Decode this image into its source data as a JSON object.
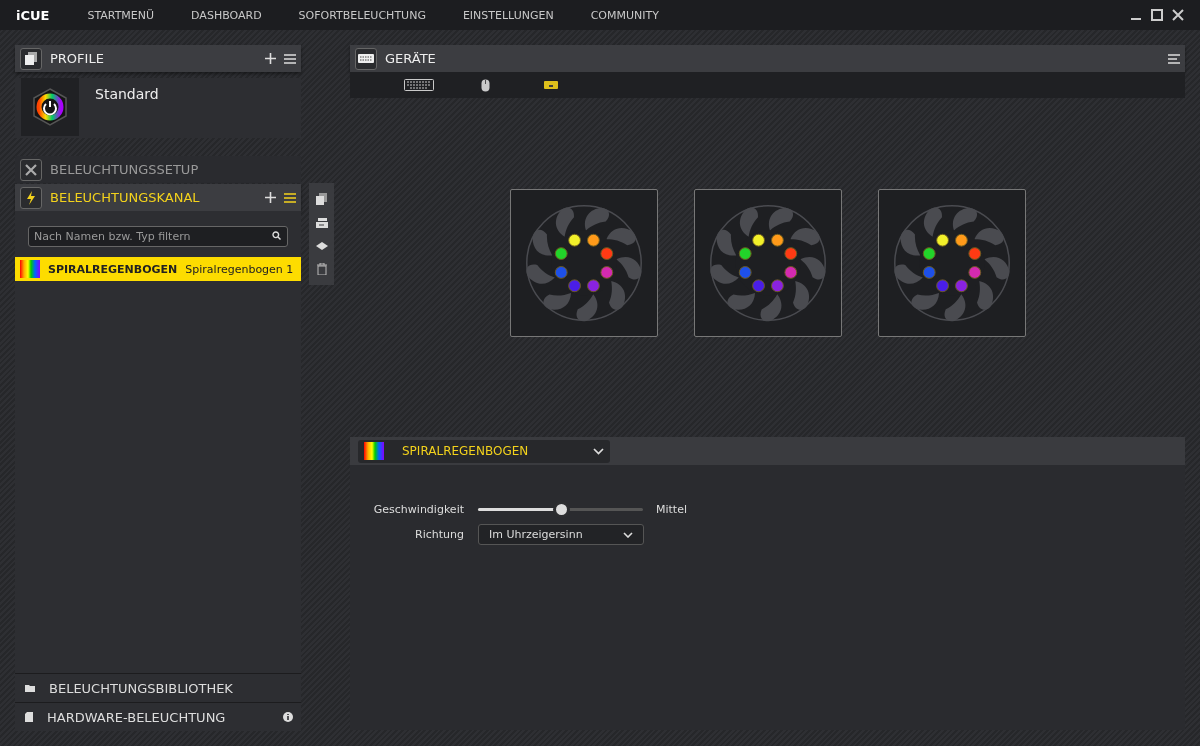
{
  "app": {
    "logo": "iCUE",
    "nav": [
      {
        "label": "STARTMENÜ"
      },
      {
        "label": "DASHBOARD"
      },
      {
        "label": "SOFORTBELEUCHTUNG"
      },
      {
        "label": "EINSTELLUNGEN"
      },
      {
        "label": "COMMUNITY"
      }
    ]
  },
  "profiles": {
    "title": "PROFILE",
    "items": [
      {
        "name": "Standard"
      }
    ]
  },
  "lighting_setup": {
    "title": "BELEUCHTUNGSSETUP"
  },
  "lighting_channel": {
    "title": "BELEUCHTUNGSKANAL",
    "search": {
      "placeholder": "Nach Namen bzw. Typ filtern"
    },
    "effects": [
      {
        "type": "SPIRALREGENBOGEN",
        "name": "Spiralregenbogen 1",
        "selected": true
      }
    ]
  },
  "library": {
    "title": "BELEUCHTUNGSBIBLIOTHEK"
  },
  "hardware_lighting": {
    "title": "HARDWARE-BELEUCHTUNG"
  },
  "devices": {
    "title": "GERÄTE",
    "tabs": [
      {
        "kind": "keyboard",
        "selected": false
      },
      {
        "kind": "mouse",
        "selected": false
      },
      {
        "kind": "controller",
        "selected": true
      }
    ],
    "fans": [
      {
        "leds": [
          {
            "color": "#f2f02a"
          },
          {
            "color": "#ff9a1a"
          },
          {
            "color": "#ff3a14"
          },
          {
            "color": "#d42ab0"
          },
          {
            "color": "#8a22e0"
          },
          {
            "color": "#4a1ee8"
          },
          {
            "color": "#1e50e8"
          },
          {
            "color": "#22d42a"
          }
        ]
      },
      {
        "leds": [
          {
            "color": "#f2f02a"
          },
          {
            "color": "#ff9a1a"
          },
          {
            "color": "#ff3a14"
          },
          {
            "color": "#d42ab0"
          },
          {
            "color": "#8a22e0"
          },
          {
            "color": "#4a1ee8"
          },
          {
            "color": "#1e50e8"
          },
          {
            "color": "#22d42a"
          }
        ]
      },
      {
        "leds": [
          {
            "color": "#f2f02a"
          },
          {
            "color": "#ff9a1a"
          },
          {
            "color": "#ff3a14"
          },
          {
            "color": "#d42ab0"
          },
          {
            "color": "#8a22e0"
          },
          {
            "color": "#4a1ee8"
          },
          {
            "color": "#1e50e8"
          },
          {
            "color": "#22d42a"
          }
        ]
      }
    ]
  },
  "effect": {
    "name": "SPIRALREGENBOGEN",
    "settings": [
      {
        "kind": "slider",
        "label": "Geschwindigkeit",
        "level": 0.5,
        "reading": "Mittel"
      },
      {
        "kind": "dropdown",
        "label": "Richtung",
        "value": "Im Uhrzeigersinn"
      }
    ]
  }
}
